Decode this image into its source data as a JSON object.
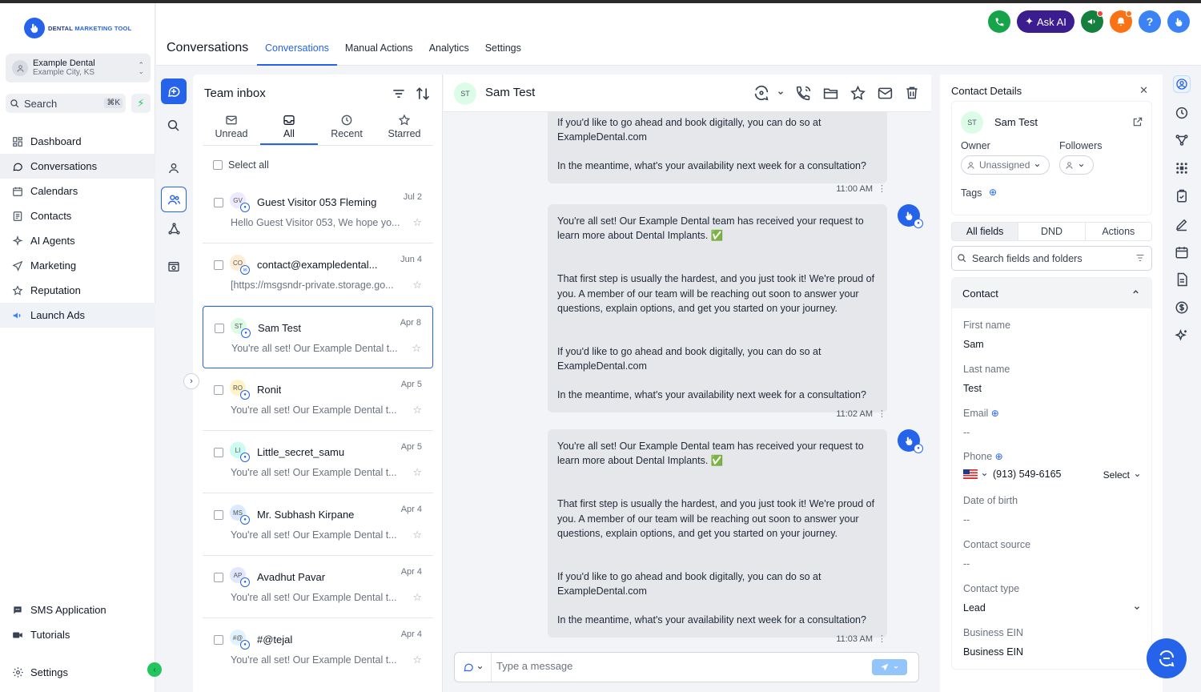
{
  "brand": {
    "logo_main": "DENTAL",
    "logo_accent": "MARKETING TOOL"
  },
  "account": {
    "name": "Example Dental",
    "location": "Example City, KS"
  },
  "search": {
    "label": "Search",
    "shortcut": "⌘K"
  },
  "nav": {
    "items": [
      {
        "label": "Dashboard",
        "icon": "dashboard-icon"
      },
      {
        "label": "Conversations",
        "icon": "chat-icon"
      },
      {
        "label": "Calendars",
        "icon": "calendar-icon"
      },
      {
        "label": "Contacts",
        "icon": "contacts-icon"
      },
      {
        "label": "AI Agents",
        "icon": "sparkle-icon"
      },
      {
        "label": "Marketing",
        "icon": "send-icon"
      },
      {
        "label": "Reputation",
        "icon": "star-icon"
      },
      {
        "label": "Launch Ads",
        "icon": "megaphone-icon"
      }
    ],
    "bottom": [
      {
        "label": "SMS Application",
        "icon": "sms-icon"
      },
      {
        "label": "Tutorials",
        "icon": "video-icon"
      }
    ],
    "settings": "Settings"
  },
  "header": {
    "title": "Conversations",
    "tabs": [
      "Conversations",
      "Manual Actions",
      "Analytics",
      "Settings"
    ],
    "ask_ai": "Ask AI"
  },
  "inbox": {
    "title": "Team inbox",
    "filters": [
      "Unread",
      "All",
      "Recent",
      "Starred"
    ],
    "select_all": "Select all",
    "conversations": [
      {
        "initials": "GV",
        "name": "Guest Visitor 053 Fleming",
        "date": "Jul 2",
        "preview": "Hello Guest Visitor 053, We hope yo...",
        "avatar_color": "#ede9fe"
      },
      {
        "initials": "CO",
        "name": "contact@exampledental...",
        "date": "Jun 4",
        "preview": "[https://msgsndr-private.storage.go...",
        "avatar_color": "#ffedd5"
      },
      {
        "initials": "ST",
        "name": "Sam Test",
        "date": "Apr 8",
        "preview": "You're all set! Our Example Dental t...",
        "avatar_color": "#dcfce7"
      },
      {
        "initials": "RO",
        "name": "Ronit",
        "date": "Apr 5",
        "preview": "You're all set! Our Example Dental t...",
        "avatar_color": "#fef3c7"
      },
      {
        "initials": "LI",
        "name": "Little_secret_samu",
        "date": "Apr 5",
        "preview": "You're all set! Our Example Dental t...",
        "avatar_color": "#ccfbf1"
      },
      {
        "initials": "MS",
        "name": "Mr. Subhash Kirpane",
        "date": "Apr 4",
        "preview": "You're all set! Our Example Dental t...",
        "avatar_color": "#dbeafe"
      },
      {
        "initials": "AP",
        "name": "Avadhut Pavar",
        "date": "Apr 4",
        "preview": "You're all set! Our Example Dental t...",
        "avatar_color": "#e0e7ff"
      },
      {
        "initials": "#@",
        "name": "#@tejal",
        "date": "Apr 4",
        "preview": "You're all set! Our Example Dental t...",
        "avatar_color": "#e0f2fe"
      }
    ]
  },
  "chat": {
    "initials": "ST",
    "name": "Sam Test",
    "messages": [
      {
        "p1": "If you'd like to go ahead and book digitally, you can do so at ExampleDental.com",
        "p2": "In the meantime, what's your availability next week for a consultation?",
        "time": "11:00 AM"
      },
      {
        "p0": "You're all set! Our Example Dental team has received your request to learn more about Dental Implants. ✅",
        "pm": "That first step is usually the hardest, and you just took it! We're proud of you. A member of our team will be reaching out soon to answer your questions, explain options, and get you started on your journey.",
        "p1": "If you'd like to go ahead and book digitally, you can do so at ExampleDental.com",
        "p2": "In the meantime, what's your availability next week for a consultation?",
        "time": "11:02 AM"
      },
      {
        "p0": "You're all set! Our Example Dental team has received your request to learn more about Dental Implants. ✅",
        "pm": "That first step is usually the hardest, and you just took it! We're proud of you. A member of our team will be reaching out soon to answer your questions, explain options, and get you started on your journey.",
        "p1": "If you'd like to go ahead and book digitally, you can do so at ExampleDental.com",
        "p2": "In the meantime, what's your availability next week for a consultation?",
        "time": "11:03 AM"
      }
    ],
    "composer_placeholder": "Type a message"
  },
  "contact": {
    "title": "Contact Details",
    "initials": "ST",
    "name": "Sam Test",
    "owner_label": "Owner",
    "owner_value": "Unassigned",
    "followers_label": "Followers",
    "tags_label": "Tags",
    "tabs": [
      "All fields",
      "DND",
      "Actions"
    ],
    "search_placeholder": "Search fields and folders",
    "section": "Contact",
    "fields": {
      "first_name_label": "First name",
      "first_name": "Sam",
      "last_name_label": "Last name",
      "last_name": "Test",
      "email_label": "Email",
      "email": "--",
      "phone_label": "Phone",
      "phone": "(913) 549-6165",
      "phone_type": "Select",
      "dob_label": "Date of birth",
      "dob": "--",
      "source_label": "Contact source",
      "source": "--",
      "type_label": "Contact type",
      "type": "Lead",
      "ein_label": "Business EIN",
      "ein": "Business EIN"
    }
  },
  "colors": {
    "primary": "#2563eb",
    "ask_ai": "#3b1d8f",
    "phone": "#16a34a",
    "notify": "#f97316"
  }
}
